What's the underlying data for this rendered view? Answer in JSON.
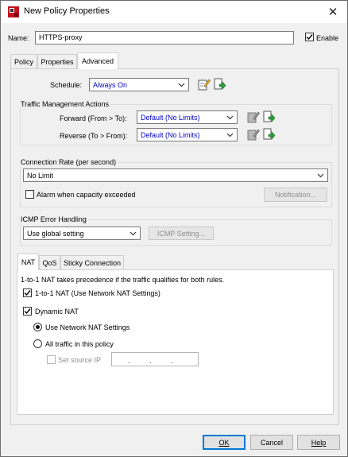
{
  "window": {
    "title": "New Policy Properties",
    "close_glyph": "✕"
  },
  "name_field": {
    "label": "Name:",
    "value": "HTTPS-proxy"
  },
  "enable": {
    "label": "Enable",
    "checked": true
  },
  "tabs": [
    {
      "label": "Policy",
      "active": false
    },
    {
      "label": "Properties",
      "active": false
    },
    {
      "label": "Advanced",
      "active": true
    }
  ],
  "schedule": {
    "label": "Schedule:",
    "value": "Always On"
  },
  "traffic_mgmt": {
    "title": "Traffic Management Actions",
    "forward": {
      "label": "Forward (From > To):",
      "value": "Default (No Limits)"
    },
    "reverse": {
      "label": "Reverse (To > From):",
      "value": "Default (No Limits)"
    }
  },
  "connection_rate": {
    "title": "Connection Rate (per second)",
    "value": "No Limit",
    "alarm_label": "Alarm when capacity exceeded",
    "alarm_checked": false,
    "notification_button": "Notification..."
  },
  "icmp": {
    "title": "ICMP Error Handling",
    "value": "Use global setting",
    "setting_button": "ICMP Setting..."
  },
  "subtabs": [
    {
      "label": "NAT",
      "active": true
    },
    {
      "label": "QoS",
      "active": false
    },
    {
      "label": "Sticky Connection",
      "active": false
    }
  ],
  "nat": {
    "info": "1-to-1 NAT takes precedence if the traffic qualifies for both rules.",
    "one_to_one_label": "1-to-1 NAT (Use Network NAT Settings)",
    "one_to_one_checked": true,
    "dynamic_label": "Dynamic NAT",
    "dynamic_checked": true,
    "use_network_label": "Use Network NAT Settings",
    "all_traffic_label": "All traffic in this policy",
    "set_source_label": "Set source IP",
    "ip_separator": "."
  },
  "buttons": {
    "ok": "OK",
    "cancel": "Cancel",
    "help": "Help"
  },
  "icons": {
    "app": "watchguard-logo-icon",
    "edit": "edit-icon",
    "add": "add-icon",
    "dropdown": "chevron-down-icon",
    "check": "checkmark-icon"
  },
  "colors": {
    "link_value": "#0000cc",
    "default_button_border": "#0078d7",
    "brand_red": "#c1121f"
  }
}
